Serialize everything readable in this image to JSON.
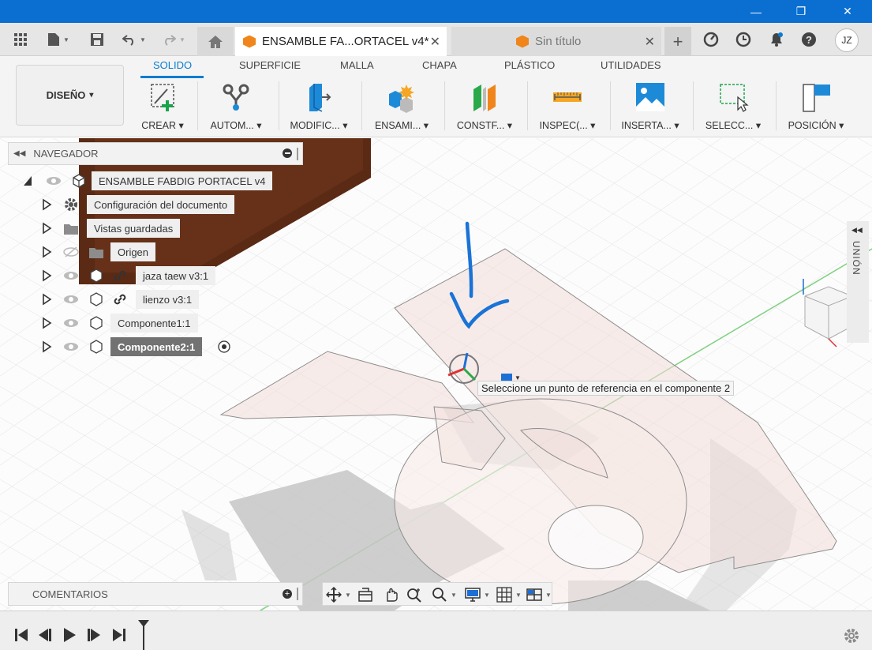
{
  "window": {
    "minimize": "—",
    "maximize": "❐",
    "close": "✕"
  },
  "tabs": {
    "active_label": "ENSAMBLE FA...ORTACEL v4*",
    "inactive_label": "Sin título",
    "close_glyph": "✕",
    "new_tab_glyph": "+"
  },
  "user": {
    "initials": "JZ"
  },
  "workspace": {
    "label": "DISEÑO",
    "caret": "▾"
  },
  "ribbon": {
    "tabs": [
      {
        "label": "SOLIDO",
        "active": true
      },
      {
        "label": "SUPERFICIE",
        "active": false
      },
      {
        "label": "MALLA",
        "active": false
      },
      {
        "label": "CHAPA",
        "active": false
      },
      {
        "label": "PLÁSTICO",
        "active": false
      },
      {
        "label": "UTILIDADES",
        "active": false
      }
    ],
    "groups": [
      {
        "label": "CREAR ▾",
        "icon": "create-sketch-icon"
      },
      {
        "label": "AUTOM... ▾",
        "icon": "automate-icon"
      },
      {
        "label": "MODIFIC... ▾",
        "icon": "modify-icon"
      },
      {
        "label": "ENSAMI... ▾",
        "icon": "assemble-icon"
      },
      {
        "label": "CONSTF... ▾",
        "icon": "construct-icon"
      },
      {
        "label": "INSPEC(... ▾",
        "icon": "inspect-icon"
      },
      {
        "label": "INSERTA... ▾",
        "icon": "insert-icon"
      },
      {
        "label": "SELECC... ▾",
        "icon": "select-icon"
      },
      {
        "label": "POSICIÓN ▾",
        "icon": "position-icon"
      }
    ]
  },
  "navigator": {
    "title": "NAVEGADOR",
    "root": "ENSAMBLE FABDIG PORTACEL v4",
    "items": [
      {
        "label": "Configuración del documento",
        "icon": "gear-icon"
      },
      {
        "label": "Vistas guardadas",
        "icon": "folder-icon"
      },
      {
        "label": "Origen",
        "icon": "folder-icon"
      },
      {
        "label": "jaza taew v3:1",
        "icon": "link-icon"
      },
      {
        "label": "lienzo v3:1",
        "icon": "link-icon"
      },
      {
        "label": "Componente1:1",
        "icon": "component-icon"
      },
      {
        "label": "Componente2:1",
        "icon": "component-icon"
      }
    ]
  },
  "tooltip": "Seleccione un punto de referencia en el componente 2",
  "right_panel": {
    "label": "UNIÓN"
  },
  "comments": {
    "label": "COMENTARIOS"
  },
  "colors": {
    "titlebar": "#0a6fd1",
    "accent": "#0a7cd0",
    "annotation": "#1a73d6",
    "part_fill": "#f3dcd8",
    "shadow": "#bdbdbd",
    "wood": "#5a2a14"
  }
}
